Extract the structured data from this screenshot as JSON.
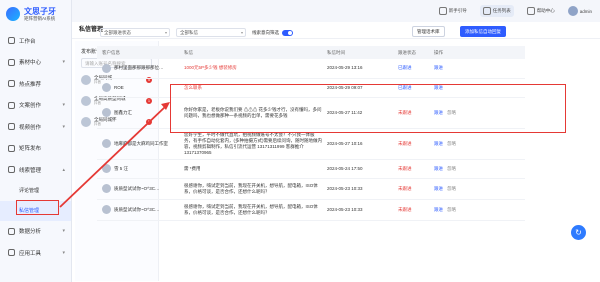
{
  "app": {
    "name": "文思子牙",
    "subtitle": "矩阵营销AI系统"
  },
  "sidebar": {
    "items": [
      {
        "label": "工作台",
        "icon": "grid-icon"
      },
      {
        "label": "素材中心",
        "icon": "folder-icon"
      },
      {
        "label": "热点推荐",
        "icon": "fire-icon"
      },
      {
        "label": "文案创作",
        "icon": "pen-icon"
      },
      {
        "label": "视频创作",
        "icon": "video-icon"
      },
      {
        "label": "矩阵发布",
        "icon": "send-icon"
      },
      {
        "label": "线索管理",
        "icon": "clue-icon"
      },
      {
        "label": "评论管理"
      },
      {
        "label": "私信管理"
      },
      {
        "label": "数据分析",
        "icon": "chart-icon"
      },
      {
        "label": "应用工具",
        "icon": "tool-icon"
      }
    ]
  },
  "header": {
    "buttons": [
      "新手引导",
      "任务列表",
      "帮助中心"
    ],
    "user": "admin"
  },
  "page": {
    "title": "私信管理"
  },
  "accounts": {
    "title": "发布账号",
    "search_placeholder": "请输入账号名称搜索",
    "items": [
      {
        "name": "全局同城",
        "platform": "抖音",
        "badge": "5"
      },
      {
        "name": "全局高质型同城",
        "platform": "抖音",
        "badge": "1"
      },
      {
        "name": "全局同城怀",
        "platform": "抖音",
        "badge": "5"
      }
    ]
  },
  "filters": {
    "status": "全部跟进状态",
    "source": "全部私信",
    "toggle_label": "线索意向筛选"
  },
  "actions": {
    "manage": "管理话术库",
    "add": "添加私信自动回复"
  },
  "table": {
    "headers": [
      "客户信息",
      "私信",
      "私信时间",
      "跟进状态",
      "操作"
    ],
    "rows": [
      {
        "customer": "那村里面那那跟那那位…",
        "message": "1000元5P多少钱 想装修房",
        "time": "2024-05-29 13:16",
        "status": "已跟进",
        "ops": [
          "跟进"
        ],
        "msg_red": "1000元5P多少钱"
      },
      {
        "customer": "ROE",
        "message": "怎么联系",
        "time": "2024-05-29 09:07",
        "status": "已跟进",
        "ops": [
          "跟进"
        ],
        "msg_red": "怎么联系"
      },
      {
        "customer": "图鑫力汇",
        "message": "你好你家是，老板你说我们要 ⚠⚠⚠ 花多少钱才行，没有懂吗，多问问题吗，我也想做那种一条视频的出单，需要花多钱",
        "time": "2024-05-27 11:42",
        "status": "未跟进",
        "ops": [
          "跟进",
          "忽略"
        ]
      },
      {
        "customer": "地麻麻都是大麻鸡同工作室",
        "message": "您好学生，平时不做代直坑，拍视频做账号不太会？不只我一体服务，有手作自动化套内，(多种拍摄方式)需要后续问询，随时随地做内容，视频剪辑制作，私信引流代运营 13171311999 客群推介 13171370965",
        "time": "2024-05-27 10:16",
        "status": "未跟进",
        "ops": [
          "跟进",
          "忽略"
        ]
      },
      {
        "customer": "雪 5 汪",
        "message": "需 *费用",
        "time": "2024-05-24 17:50",
        "status": "未跟进",
        "ops": [
          "跟进",
          "忽略"
        ]
      },
      {
        "customer": "质质型试试你~O^3C…",
        "message": "很感谢你，嗨试定到当前，我现在开关机，想导航，配电箱，ISO体系，价格可谈，是否合作，还想什么呢吗？",
        "time": "2024-05-23 10:33",
        "status": "未跟进",
        "ops": [
          "跟进",
          "忽略"
        ]
      },
      {
        "customer": "质质型试试你~O^3C…",
        "message": "很感谢你，嗨试定到当前，我现在开关机，想导航，配电箱，ISO体系，价格可谈，是否合作，还想什么呢吗？",
        "time": "2024-05-23 10:33",
        "status": "未跟进",
        "ops": [
          "跟进",
          "忽略"
        ]
      }
    ]
  },
  "colors": {
    "accent": "#2e5cff",
    "highlight": "#e53935"
  }
}
